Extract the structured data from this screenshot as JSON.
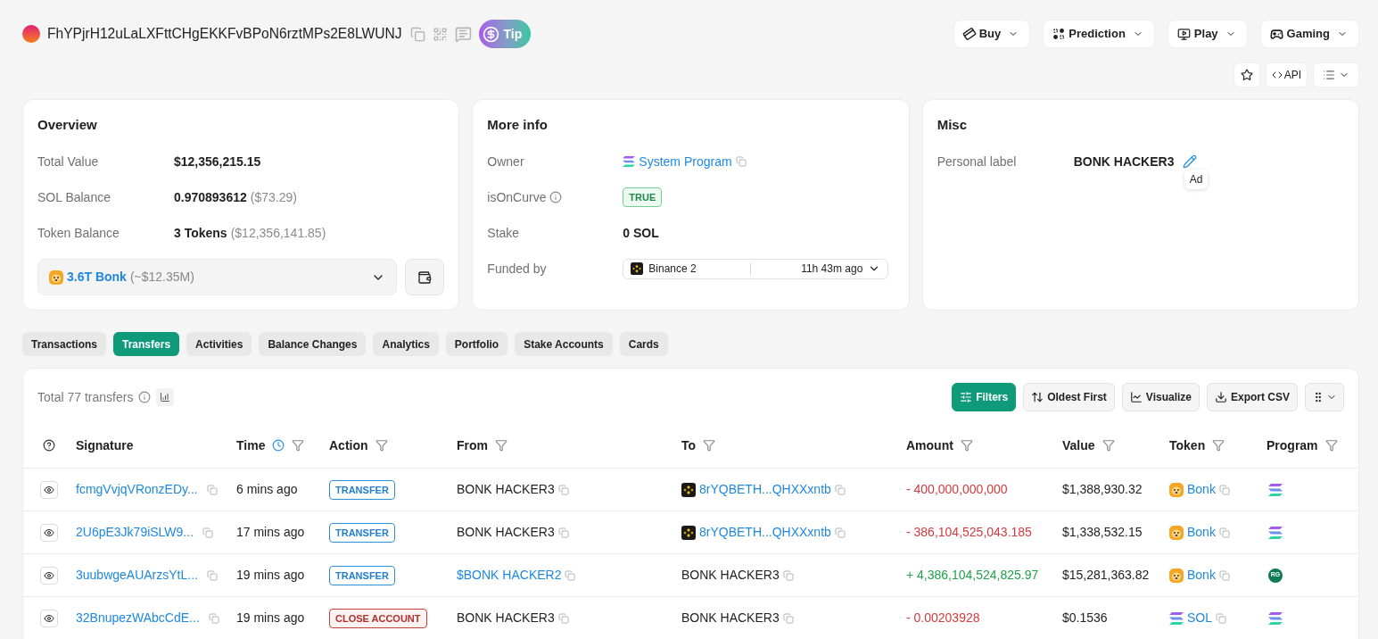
{
  "header": {
    "address": "FhYPjrH12uLaLXFttCHgEKKFvBPoN6rztMPs2E8LWUNJ",
    "tip": "Tip"
  },
  "menus": [
    {
      "label": "Buy"
    },
    {
      "label": "Prediction"
    },
    {
      "label": "Play"
    },
    {
      "label": "Gaming"
    }
  ],
  "actions": {
    "api": "API"
  },
  "overview": {
    "title": "Overview",
    "rows": [
      {
        "label": "Total Value",
        "value": "$12,356,215.15"
      },
      {
        "label": "SOL Balance",
        "value": "0.970893612",
        "note": "($73.29)"
      },
      {
        "label": "Token Balance",
        "value": "3 Tokens",
        "note": "($12,356,141.85)"
      }
    ],
    "token_select": {
      "value": "3.6T Bonk",
      "note": "(~$12.35M)"
    }
  },
  "more_info": {
    "title": "More info",
    "rows": [
      {
        "kind": "link",
        "label": "Owner",
        "value": "System Program"
      },
      {
        "kind": "badge",
        "label": "isOnCurve",
        "value": "TRUE"
      },
      {
        "kind": "text",
        "label": "Stake",
        "value": "0 SOL"
      },
      {
        "kind": "funder",
        "label": "Funded by",
        "value": "Binance 2",
        "time": "11h 43m ago"
      }
    ]
  },
  "misc": {
    "title": "Misc",
    "rows": [
      {
        "label": "Personal label",
        "value": "BONK HACKER3"
      }
    ],
    "tooltip": "Ad"
  },
  "tabs": [
    {
      "label": "Transactions",
      "selected": false
    },
    {
      "label": "Transfers",
      "selected": true
    },
    {
      "label": "Activities",
      "selected": false
    },
    {
      "label": "Balance Changes",
      "selected": false
    },
    {
      "label": "Analytics",
      "selected": false
    },
    {
      "label": "Portfolio",
      "selected": false
    },
    {
      "label": "Stake Accounts",
      "selected": false
    },
    {
      "label": "Cards",
      "selected": false
    }
  ],
  "transfers": {
    "total": "Total 77 transfers",
    "buttons": [
      {
        "label": "Filters",
        "kind": "primary"
      },
      {
        "label": "Oldest First",
        "kind": "default"
      },
      {
        "label": "Visualize",
        "kind": "default"
      },
      {
        "label": "Export CSV",
        "kind": "default"
      }
    ],
    "columns": [
      {
        "label": "Signature",
        "filter": false,
        "clock": false
      },
      {
        "label": "Time",
        "filter": true,
        "clock": true
      },
      {
        "label": "Action",
        "filter": true,
        "clock": false
      },
      {
        "label": "From",
        "filter": true,
        "clock": false
      },
      {
        "label": "To",
        "filter": true,
        "clock": false
      },
      {
        "label": "Amount",
        "filter": true,
        "clock": false
      },
      {
        "label": "Value",
        "filter": true,
        "clock": false
      },
      {
        "label": "Token",
        "filter": true,
        "clock": false
      },
      {
        "label": "Program",
        "filter": true,
        "clock": false
      }
    ],
    "rows": [
      {
        "signature": "fcmgVvjqVRonzEDy...",
        "time": "6 mins ago",
        "action": {
          "label": "TRANSFER",
          "kind": "transfer"
        },
        "from": {
          "text": "BONK HACKER3",
          "link": false,
          "logo": false
        },
        "to": {
          "text": "8rYQBETH...QHXXxntb",
          "link": true,
          "logo": true
        },
        "amount": "- 400,000,000,000",
        "incoming": false,
        "value": "$1,388,930.32",
        "token": {
          "symbol": "Bonk",
          "kind": "bonk"
        },
        "program": {
          "kind": "stripes"
        }
      },
      {
        "signature": "2U6pE3Jk79iSLW9...",
        "time": "17 mins ago",
        "action": {
          "label": "TRANSFER",
          "kind": "transfer"
        },
        "from": {
          "text": "BONK HACKER3",
          "link": false,
          "logo": false
        },
        "to": {
          "text": "8rYQBETH...QHXXxntb",
          "link": true,
          "logo": true
        },
        "amount": "- 386,104,525,043.185",
        "incoming": false,
        "value": "$1,338,532.15",
        "token": {
          "symbol": "Bonk",
          "kind": "bonk"
        },
        "program": {
          "kind": "stripes"
        }
      },
      {
        "signature": "3uubwgeAUArzsYtL...",
        "time": "19 mins ago",
        "action": {
          "label": "TRANSFER",
          "kind": "transfer"
        },
        "from": {
          "text": "$BONK HACKER2",
          "link": true,
          "logo": false
        },
        "to": {
          "text": "BONK HACKER3",
          "link": false,
          "logo": false
        },
        "amount": "+ 4,386,104,524,825.97",
        "incoming": true,
        "value": "$15,281,363.82",
        "token": {
          "symbol": "Bonk",
          "kind": "bonk"
        },
        "program": {
          "kind": "badge",
          "text": "RG"
        }
      },
      {
        "signature": "32BnupezWAbcCdE...",
        "time": "19 mins ago",
        "action": {
          "label": "CLOSE ACCOUNT",
          "kind": "close"
        },
        "from": {
          "text": "BONK HACKER3",
          "link": false,
          "logo": false
        },
        "to": {
          "text": "BONK HACKER3",
          "link": false,
          "logo": false
        },
        "amount": "- 0.00203928",
        "incoming": false,
        "value": "$0.1536",
        "token": {
          "symbol": "SOL",
          "kind": "sol"
        },
        "program": {
          "kind": "stripes"
        }
      }
    ]
  }
}
